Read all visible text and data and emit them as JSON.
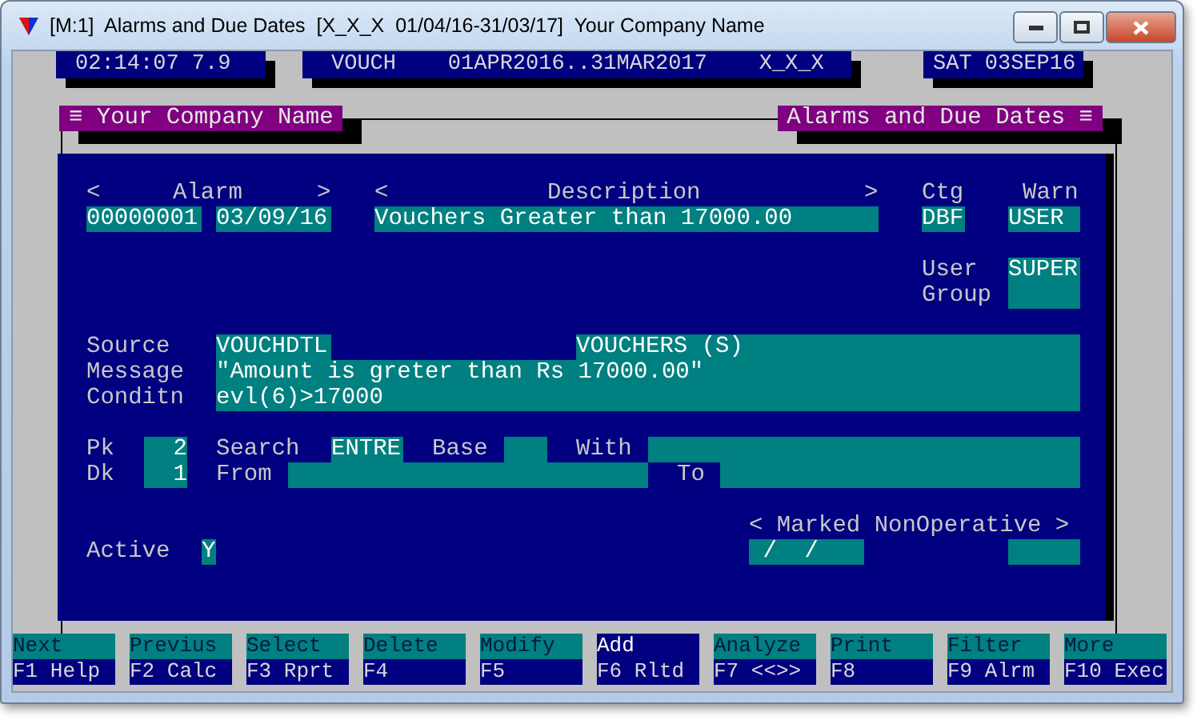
{
  "window": {
    "title": "[M:1]  Alarms and Due Dates  [X_X_X  01/04/16-31/03/17]  Your Company Name"
  },
  "info_bar": [
    "02:14:07 7.9",
    "VOUCH    01APR2016..31MAR2017    X_X_X",
    "SAT 03SEP16"
  ],
  "header_tabs": [
    "≡ Your Company Name",
    "Alarms and Due Dates ≡"
  ],
  "form": [
    {
      "kind": "label",
      "text": "<"
    },
    {
      "kind": "label",
      "text": "Alarm"
    },
    {
      "kind": "label",
      "text": ">"
    },
    {
      "kind": "label",
      "text": "<"
    },
    {
      "kind": "label",
      "text": "Description"
    },
    {
      "kind": "label",
      "text": ">"
    },
    {
      "kind": "label",
      "text": "Ctg"
    },
    {
      "kind": "label",
      "text": "Warn"
    },
    {
      "kind": "field",
      "text": "00000001"
    },
    {
      "kind": "field",
      "text": "03/09/16"
    },
    {
      "kind": "field",
      "text": "Vouchers Greater than 17000.00"
    },
    {
      "kind": "field",
      "text": "DBF"
    },
    {
      "kind": "field",
      "text": "USER"
    },
    {
      "kind": "label",
      "text": "User"
    },
    {
      "kind": "label",
      "text": "Group"
    },
    {
      "kind": "field",
      "text": "SUPER"
    },
    {
      "kind": "label",
      "text": "Source"
    },
    {
      "kind": "field",
      "text": "VOUCHDTL"
    },
    {
      "kind": "field",
      "text": "VOUCHERS (S)"
    },
    {
      "kind": "label",
      "text": "Message"
    },
    {
      "kind": "field",
      "text": "\"Amount is greter than Rs 17000.00\""
    },
    {
      "kind": "label",
      "text": "Conditn"
    },
    {
      "kind": "field",
      "text": "evl(6)>17000"
    },
    {
      "kind": "label",
      "text": "Pk"
    },
    {
      "kind": "field",
      "text": "2"
    },
    {
      "kind": "label",
      "text": "Search"
    },
    {
      "kind": "field",
      "text": "ENTRE"
    },
    {
      "kind": "label",
      "text": "Base"
    },
    {
      "kind": "field"
    },
    {
      "kind": "label",
      "text": "With"
    },
    {
      "kind": "field"
    },
    {
      "kind": "label",
      "text": "Dk"
    },
    {
      "kind": "field",
      "text": "1"
    },
    {
      "kind": "label",
      "text": "From"
    },
    {
      "kind": "field"
    },
    {
      "kind": "label",
      "text": "To"
    },
    {
      "kind": "field"
    },
    {
      "kind": "label",
      "text": "< Marked NonOperative >"
    },
    {
      "kind": "label",
      "text": "Active"
    },
    {
      "kind": "field",
      "text": "Y"
    },
    {
      "kind": "field",
      "text": " /  /"
    },
    {
      "kind": "field"
    }
  ],
  "function_keys": [
    {
      "action": "Next",
      "key": "F1 Help",
      "selected": false
    },
    {
      "action": "Previus",
      "key": "F2 Calc",
      "selected": false
    },
    {
      "action": "Select",
      "key": "F3 Rprt",
      "selected": false
    },
    {
      "action": "Delete",
      "key": "F4",
      "selected": false
    },
    {
      "action": "Modify",
      "key": "F5",
      "selected": false
    },
    {
      "action": "Add",
      "key": "F6 Rltd",
      "selected": true
    },
    {
      "action": "Analyze",
      "key": "F7 <<>>",
      "selected": false
    },
    {
      "action": "Print",
      "key": "F8",
      "selected": false
    },
    {
      "action": "Filter",
      "key": "F9 Alrm",
      "selected": false
    },
    {
      "action": "More",
      "key": "F10 Exec",
      "selected": false
    }
  ]
}
